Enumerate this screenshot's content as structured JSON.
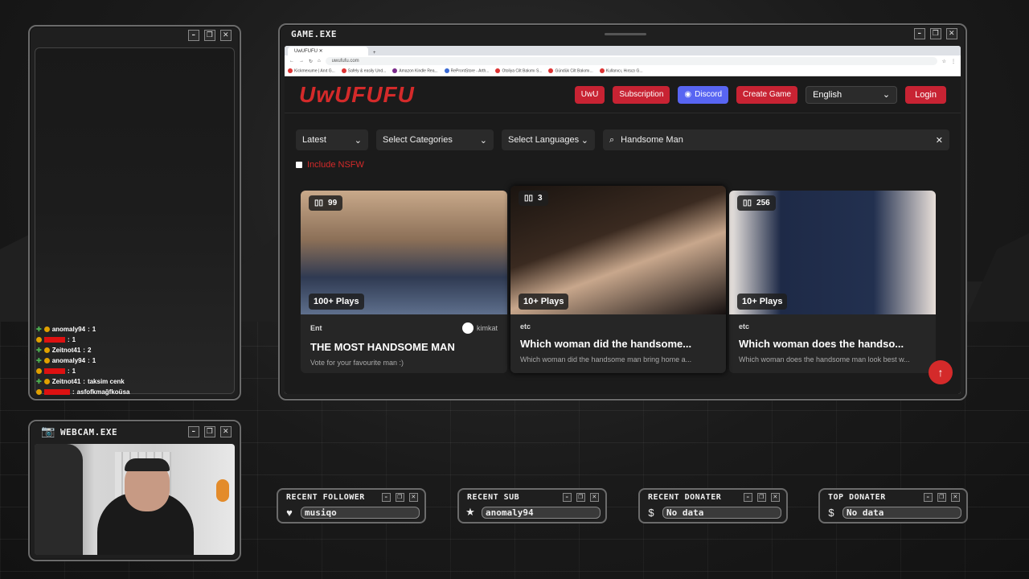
{
  "colors": {
    "accent": "#d42a2a",
    "discord": "#5865f2",
    "frame": "#6b6b6b"
  },
  "left_panel": {
    "chat": [
      {
        "user": "anomaly94",
        "msg": "1",
        "red": false
      },
      {
        "user": "",
        "msg": "1",
        "red": true
      },
      {
        "user": "Zeitnot41",
        "msg": "2",
        "red": false
      },
      {
        "user": "anomaly94",
        "msg": "1",
        "red": false
      },
      {
        "user": "",
        "msg": "1",
        "red": true
      },
      {
        "user": "Zeitnot41",
        "msg": "taksim cenk",
        "red": false
      },
      {
        "user": "",
        "msg": "asfofkmağfkoüsa",
        "red": true
      }
    ]
  },
  "game_window": {
    "title": "GAME.EXE"
  },
  "webcam_window": {
    "title": "WEBCAM.EXE"
  },
  "browser": {
    "tab_title": "UwUFUFU",
    "url": "uwufufu.com",
    "bookmarks": [
      "Kickmexume | Anıt G...",
      "Safely & easily Und...",
      "Amazon Kindle Rea...",
      "ReProntStore - Arth...",
      "Otoliya Cilt Bakımı S...",
      "Gündük Cilt Bakımı...",
      "Kullanıcı, Hırsızı G..."
    ]
  },
  "site": {
    "logo": "UwUFUFU",
    "nav": {
      "uwu": "UwU",
      "subscription": "Subscription",
      "discord": "Discord",
      "create_game": "Create Game",
      "language": "English",
      "login": "Login"
    },
    "filters": {
      "sort": "Latest",
      "categories": "Select Categories",
      "languages": "Select Languages",
      "search_value": "Handsome Man"
    },
    "nsfw_label": "Include NSFW",
    "cards": [
      {
        "count": "99",
        "plays": "100+ Plays",
        "category": "Ent",
        "author": "kimkat",
        "title": "THE MOST HANDSOME MAN",
        "desc": "Vote for your favourite man :)"
      },
      {
        "count": "3",
        "plays": "10+ Plays",
        "category": "etc",
        "author": "",
        "title": "Which woman did the handsome...",
        "desc": "Which woman did the handsome man bring home a..."
      },
      {
        "count": "256",
        "plays": "10+ Plays",
        "category": "etc",
        "author": "",
        "title": "Which woman does the handso...",
        "desc": "Which woman does the handsome man look best w..."
      }
    ]
  },
  "widgets": [
    {
      "title": "RECENT FOLLOWER",
      "icon": "heart-icon",
      "glyph": "♥",
      "value": "musiqo"
    },
    {
      "title": "RECENT SUB",
      "icon": "star-icon",
      "glyph": "★",
      "value": "anomaly94"
    },
    {
      "title": "RECENT DONATER",
      "icon": "dollar-icon",
      "glyph": "$",
      "value": "No data"
    },
    {
      "title": "TOP DONATER",
      "icon": "dollar-icon",
      "glyph": "$",
      "value": "No data"
    }
  ]
}
